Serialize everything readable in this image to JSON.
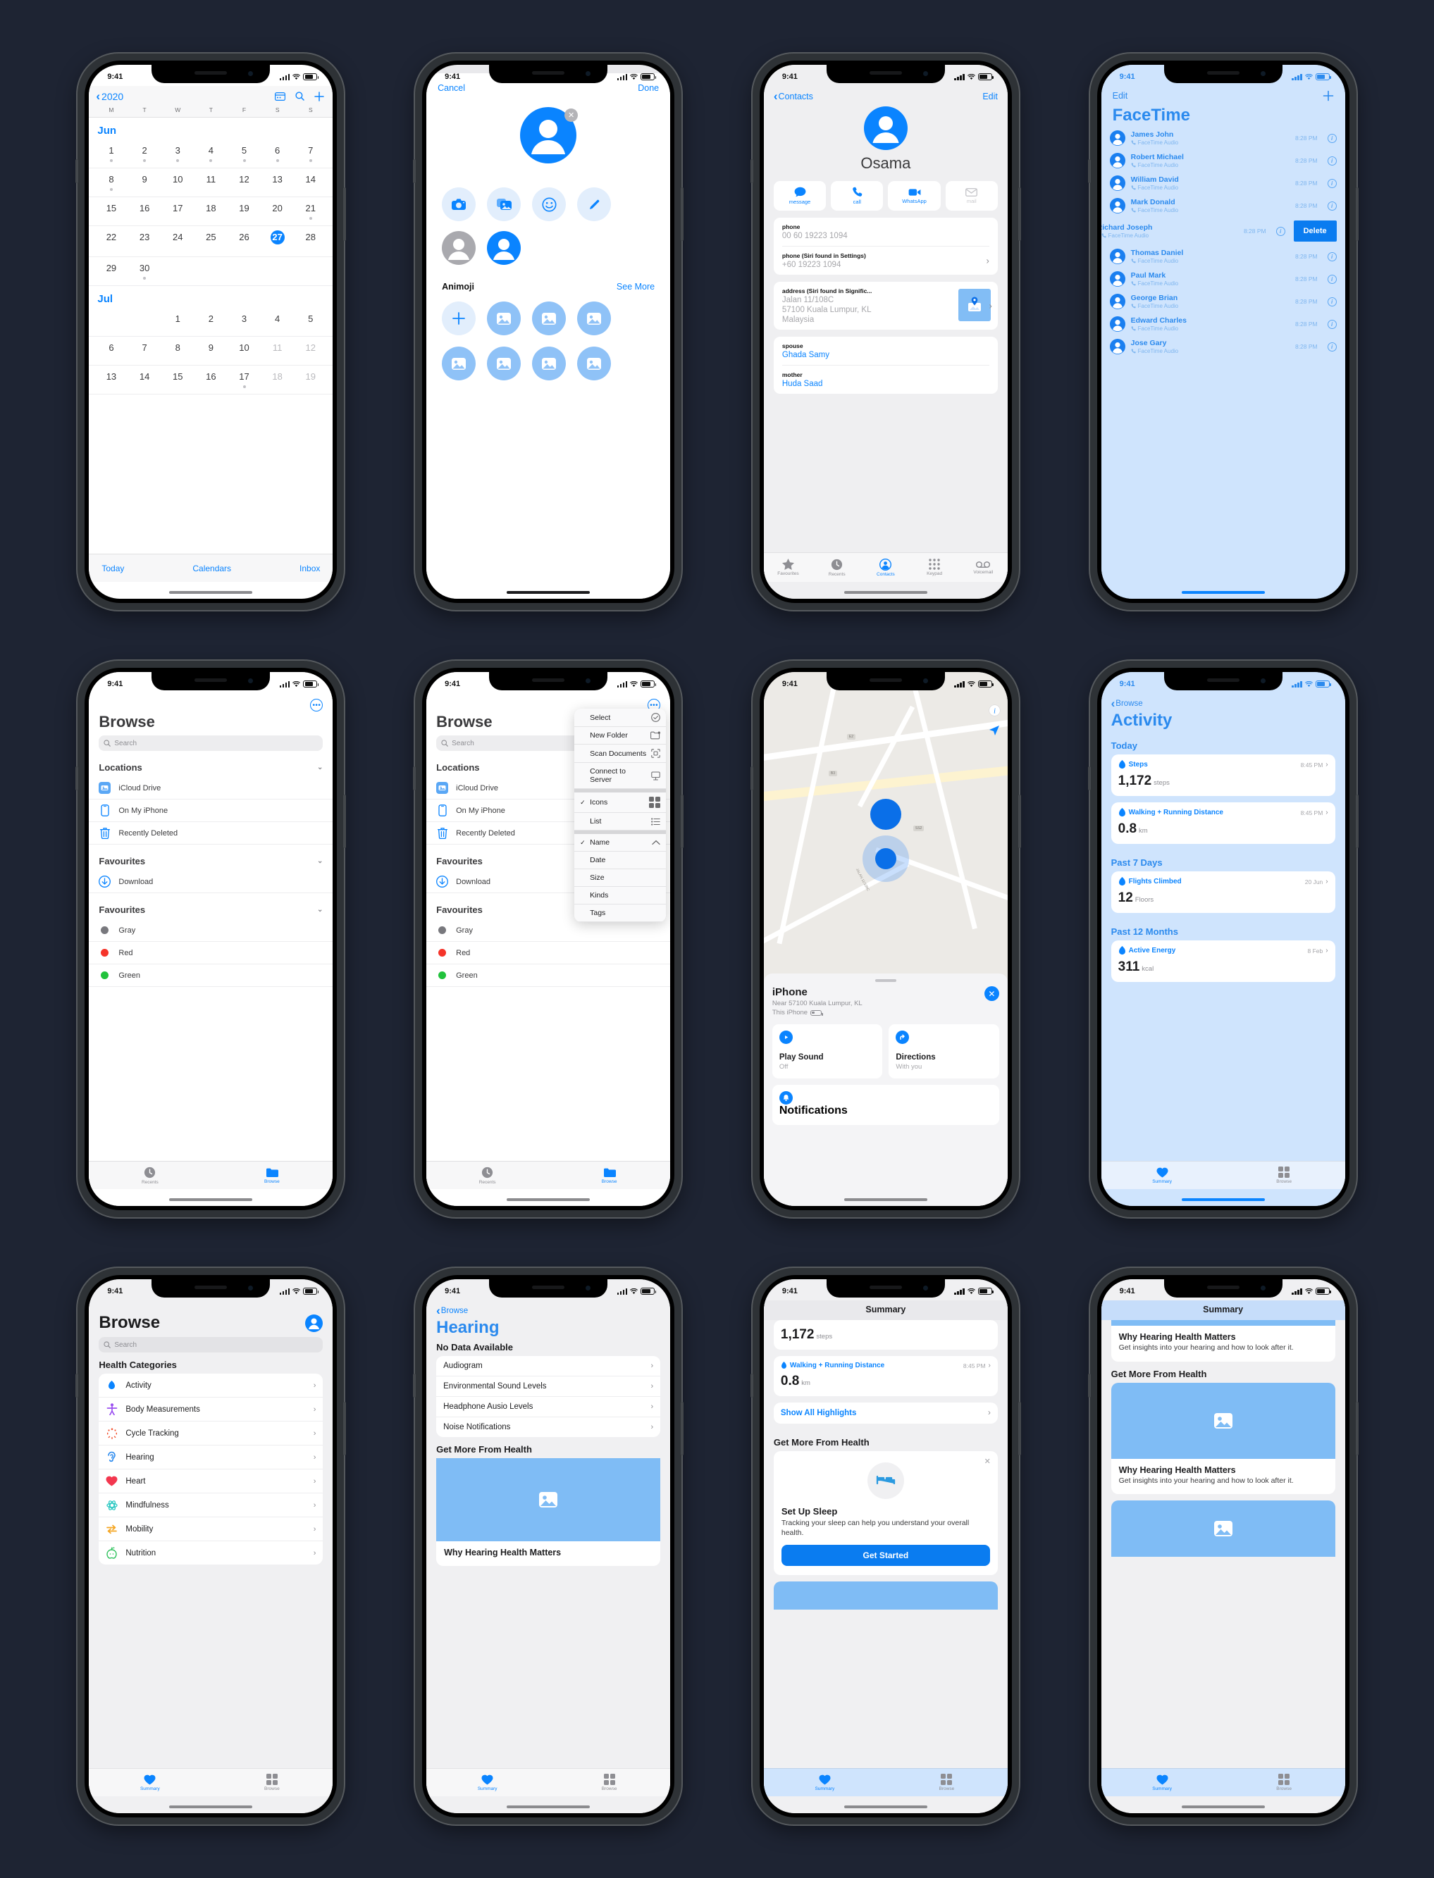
{
  "status_bar": {
    "time": "9:41"
  },
  "calendar": {
    "back_label": "2020",
    "weekdays": [
      "M",
      "T",
      "W",
      "T",
      "F",
      "S",
      "S"
    ],
    "months": [
      {
        "name": "Jun",
        "weeks": [
          [
            {
              "d": "1",
              "dot": true
            },
            {
              "d": "2",
              "dot": true
            },
            {
              "d": "3",
              "dot": true
            },
            {
              "d": "4",
              "dot": true
            },
            {
              "d": "5",
              "dot": true
            },
            {
              "d": "6",
              "dot": true
            },
            {
              "d": "7",
              "dot": true
            }
          ],
          [
            {
              "d": "8",
              "dot": true
            },
            {
              "d": "9"
            },
            {
              "d": "10"
            },
            {
              "d": "11"
            },
            {
              "d": "12"
            },
            {
              "d": "13"
            },
            {
              "d": "14"
            }
          ],
          [
            {
              "d": "15"
            },
            {
              "d": "16"
            },
            {
              "d": "17"
            },
            {
              "d": "18"
            },
            {
              "d": "19"
            },
            {
              "d": "20"
            },
            {
              "d": "21",
              "dot": true
            }
          ],
          [
            {
              "d": "22"
            },
            {
              "d": "23"
            },
            {
              "d": "24"
            },
            {
              "d": "25"
            },
            {
              "d": "26"
            },
            {
              "d": "27",
              "today": true
            },
            {
              "d": "28"
            }
          ],
          [
            {
              "d": "29"
            },
            {
              "d": "30",
              "dot": true
            },
            {
              "d": ""
            },
            {
              "d": ""
            },
            {
              "d": ""
            },
            {
              "d": ""
            },
            {
              "d": ""
            }
          ]
        ]
      },
      {
        "name": "Jul",
        "weeks": [
          [
            {
              "d": ""
            },
            {
              "d": ""
            },
            {
              "d": "1"
            },
            {
              "d": "2"
            },
            {
              "d": "3"
            },
            {
              "d": "4"
            },
            {
              "d": "5"
            }
          ],
          [
            {
              "d": "6"
            },
            {
              "d": "7"
            },
            {
              "d": "8"
            },
            {
              "d": "9"
            },
            {
              "d": "10"
            },
            {
              "d": "11",
              "muted": true
            },
            {
              "d": "12",
              "muted": true
            }
          ],
          [
            {
              "d": "13"
            },
            {
              "d": "14"
            },
            {
              "d": "15"
            },
            {
              "d": "16"
            },
            {
              "d": "17",
              "dot": true
            },
            {
              "d": "18",
              "muted": true
            },
            {
              "d": "19",
              "muted": true
            }
          ]
        ]
      }
    ],
    "toolbar": {
      "today": "Today",
      "calendars": "Calendars",
      "inbox": "Inbox"
    },
    "icons": {
      "back": "chevron-left-icon",
      "list": "list-view-icon",
      "search": "search-icon",
      "add": "plus-icon"
    }
  },
  "photo_picker": {
    "cancel": "Cancel",
    "done": "Done",
    "options_row1": [
      "camera-icon",
      "photos-icon",
      "memoji-icon",
      "pencil-icon"
    ],
    "options_row2": [
      "avatar-gray-icon",
      "avatar-blue-icon"
    ],
    "animoji_header": "Animoji",
    "see_more": "See More",
    "tiles": [
      "add",
      "image",
      "image",
      "image",
      "image",
      "image",
      "image",
      "image"
    ]
  },
  "contact": {
    "back": "Contacts",
    "edit": "Edit",
    "name": "Osama",
    "actions": [
      {
        "label": "message",
        "icon": "message-bubble-icon",
        "dim": false
      },
      {
        "label": "call",
        "icon": "phone-icon",
        "dim": false
      },
      {
        "label": "WhatsApp",
        "icon": "video-camera-icon",
        "dim": false
      },
      {
        "label": "mail",
        "icon": "envelope-icon",
        "dim": true
      }
    ],
    "fields": [
      {
        "label": "phone",
        "value": "00 60 19223 1094",
        "chev": false
      },
      {
        "label": "phone (Siri found in Settings)",
        "value": "+60 19223 1094",
        "chev": true
      }
    ],
    "address": {
      "label": "address (Siri found in Signific...",
      "lines": [
        "Jalan 11/108C",
        "57100 Kuala Lumpur,  KL",
        "Malaysia"
      ]
    },
    "relations": [
      {
        "label": "spouse",
        "value": "Ghada Samy"
      },
      {
        "label": "mother",
        "value": "Huda Saad"
      }
    ],
    "tabs": [
      {
        "label": "Favourites",
        "icon": "star-icon",
        "active": false
      },
      {
        "label": "Recents",
        "icon": "clock-icon",
        "active": false
      },
      {
        "label": "Contacts",
        "icon": "person-circle-icon",
        "active": true
      },
      {
        "label": "Keypad",
        "icon": "keypad-icon",
        "active": false
      },
      {
        "label": "Voicemail",
        "icon": "voicemail-icon",
        "active": false
      }
    ]
  },
  "facetime": {
    "edit": "Edit",
    "add": "+",
    "title": "FaceTime",
    "calls": [
      {
        "name": "James John",
        "type": "FaceTime Audio",
        "time": "8:28 PM",
        "swiped": false
      },
      {
        "name": "Robert Michael",
        "type": "FaceTime Audio",
        "time": "8:28 PM",
        "swiped": false
      },
      {
        "name": "William David",
        "type": "FaceTime Audio",
        "time": "8:28 PM",
        "swiped": false
      },
      {
        "name": "Mark Donald",
        "type": "FaceTime Audio",
        "time": "8:28 PM",
        "swiped": false
      },
      {
        "name": "Richard Joseph",
        "type": "FaceTime Audio",
        "time": "8:28 PM",
        "swiped": true,
        "delete_label": "Delete"
      },
      {
        "name": "Thomas Daniel",
        "type": "FaceTime Audio",
        "time": "8:28 PM",
        "swiped": false
      },
      {
        "name": "Paul Mark",
        "type": "FaceTime Audio",
        "time": "8:28 PM",
        "swiped": false
      },
      {
        "name": "George Brian",
        "type": "FaceTime Audio",
        "time": "8:28 PM",
        "swiped": false
      },
      {
        "name": "Edward Charles",
        "type": "FaceTime Audio",
        "time": "8:28 PM",
        "swiped": false
      },
      {
        "name": "Jose Gary",
        "type": "FaceTime Audio",
        "time": "8:28 PM",
        "swiped": false
      }
    ]
  },
  "files": {
    "title": "Browse",
    "search_placeholder": "Search",
    "sections": [
      {
        "title": "Locations",
        "items": [
          {
            "label": "iCloud Drive",
            "icon": "icloud-drive-icon",
            "color": "#5aa7f5"
          },
          {
            "label": "On My iPhone",
            "icon": "iphone-icon",
            "color": "#0a84ff"
          },
          {
            "label": "Recently Deleted",
            "icon": "trash-icon",
            "color": "#0a84ff"
          }
        ]
      },
      {
        "title": "Favourites",
        "items": [
          {
            "label": "Download",
            "icon": "download-circle-icon",
            "color": "#0a84ff"
          }
        ]
      },
      {
        "title": "Favourites",
        "items": [
          {
            "label": "Gray",
            "icon": "tag-dot-icon",
            "color": "#78787d"
          },
          {
            "label": "Red",
            "icon": "tag-dot-icon",
            "color": "#f5342a"
          },
          {
            "label": "Green",
            "icon": "tag-dot-icon",
            "color": "#21c23c"
          }
        ]
      }
    ],
    "tabs": [
      {
        "label": "Recents",
        "icon": "clock-icon",
        "active": false
      },
      {
        "label": "Browse",
        "icon": "folder-icon",
        "active": true
      }
    ],
    "menu": {
      "groups": [
        [
          {
            "label": "Select",
            "icon": "check-circle-icon",
            "checked": false
          },
          {
            "label": "New Folder",
            "icon": "new-folder-icon",
            "checked": false
          },
          {
            "label": "Scan Documents",
            "icon": "scan-icon",
            "checked": false
          },
          {
            "label": "Connect to Server",
            "icon": "server-icon",
            "checked": false
          }
        ],
        [
          {
            "label": "Icons",
            "icon": "grid-icon",
            "checked": true
          },
          {
            "label": "List",
            "icon": "list-icon",
            "checked": false
          }
        ],
        [
          {
            "label": "Name",
            "icon": "chevron-up-icon",
            "checked": true
          },
          {
            "label": "Date",
            "icon": "",
            "checked": false
          },
          {
            "label": "Size",
            "icon": "",
            "checked": false
          },
          {
            "label": "Kinds",
            "icon": "",
            "checked": false
          },
          {
            "label": "Tags",
            "icon": "",
            "checked": false
          }
        ]
      ]
    }
  },
  "findmy": {
    "device": "iPhone",
    "near": "Near 57100 Kuala Lumpur, KL",
    "this_device": "This iPhone",
    "cards": [
      {
        "title": "Play Sound",
        "sub": "Off",
        "icon": "play-circle-icon"
      },
      {
        "title": "Directions",
        "sub": "With you",
        "icon": "directions-arrow-icon"
      }
    ],
    "notifications": {
      "title": "Notifications",
      "icon": "bell-icon"
    },
    "map_labels": [
      "JALAN 11/108C"
    ],
    "map_badges": [
      "E2",
      "B3",
      "SS2"
    ],
    "icons": {
      "info": "info-circle-icon",
      "locate": "locate-arrow-icon",
      "close": "close-icon"
    }
  },
  "activity": {
    "back": "Browse",
    "title": "Activity",
    "sections": [
      {
        "title": "Today",
        "cards": [
          {
            "metric": "Steps",
            "time": "8:45 PM",
            "value": "1,172",
            "unit": "steps"
          },
          {
            "metric": "Walking + Running Distance",
            "time": "8:45 PM",
            "value": "0.8",
            "unit": "km"
          }
        ]
      },
      {
        "title": "Past 7 Days",
        "cards": [
          {
            "metric": "Flights Climbed",
            "time": "20 Jun",
            "value": "12",
            "unit": "Floors"
          }
        ]
      },
      {
        "title": "Past 12 Months",
        "cards": [
          {
            "metric": "Active Energy",
            "time": "8 Feb",
            "value": "311",
            "unit": "kcal"
          }
        ]
      }
    ],
    "tabs": [
      {
        "label": "Summary",
        "icon": "heart-icon",
        "active": true
      },
      {
        "label": "Browse",
        "icon": "grid-icon",
        "active": false
      }
    ]
  },
  "health_browse": {
    "title": "Browse",
    "search_placeholder": "Search",
    "section_title": "Health Categories",
    "categories": [
      {
        "label": "Activity",
        "icon": "flame-icon",
        "color": "#0a84ff"
      },
      {
        "label": "Body Measurements",
        "icon": "body-icon",
        "color": "#9b4ff0"
      },
      {
        "label": "Cycle Tracking",
        "icon": "cycle-icon",
        "color": "#f2502e"
      },
      {
        "label": "Hearing",
        "icon": "ear-icon",
        "color": "#2b8aee"
      },
      {
        "label": "Heart",
        "icon": "heart-icon",
        "color": "#f3374f"
      },
      {
        "label": "Mindfulness",
        "icon": "mindfulness-icon",
        "color": "#2fc9c3"
      },
      {
        "label": "Mobility",
        "icon": "mobility-icon",
        "color": "#f5a623"
      },
      {
        "label": "Nutrition",
        "icon": "apple-icon",
        "color": "#2ec25c"
      }
    ],
    "tabs": [
      {
        "label": "Summary",
        "icon": "heart-icon",
        "active": true
      },
      {
        "label": "Browse",
        "icon": "grid-icon",
        "active": false
      }
    ]
  },
  "hearing": {
    "back": "Browse",
    "title": "Hearing",
    "section_title": "No Data Available",
    "rows": [
      "Audiogram",
      "Environmental Sound Levels",
      "Headphone Ausio Levels",
      "Noise Notifications"
    ],
    "promo_header": "Get More From Health",
    "promo_title": "Why Hearing Health Matters",
    "tabs": [
      {
        "label": "Summary",
        "icon": "heart-icon",
        "active": true
      },
      {
        "label": "Browse",
        "icon": "grid-icon",
        "active": false
      }
    ]
  },
  "summary": {
    "nav_title": "Summary",
    "steps": {
      "value": "1,172",
      "unit": "steps"
    },
    "distance": {
      "metric": "Walking + Running Distance",
      "time": "8:45 PM",
      "value": "0.8",
      "unit": "km"
    },
    "show_all": "Show All Highlights",
    "promo_header": "Get More From Health",
    "sleep": {
      "title": "Set Up Sleep",
      "body": "Tracking your sleep can help you understand your overall health.",
      "cta": "Get Started",
      "icon": "bed-icon"
    },
    "tabs": [
      {
        "label": "Summary",
        "icon": "heart-icon",
        "active": true
      },
      {
        "label": "Browse",
        "icon": "grid-icon",
        "active": false
      }
    ]
  },
  "summary_hearing": {
    "nav_title": "Summary",
    "card_title": "Why Hearing Health Matters",
    "card_body": "Get insights into your hearing and how to look after it.",
    "promo_header": "Get More From Health",
    "tabs": [
      {
        "label": "Summary",
        "icon": "heart-icon",
        "active": true
      },
      {
        "label": "Browse",
        "icon": "grid-icon",
        "active": false
      }
    ]
  },
  "colors": {
    "accent": "#0a84ff",
    "tint_bg": "#cfe4fd",
    "page_bg": "#1e2433",
    "gray_bg": "#f0f0f2"
  }
}
